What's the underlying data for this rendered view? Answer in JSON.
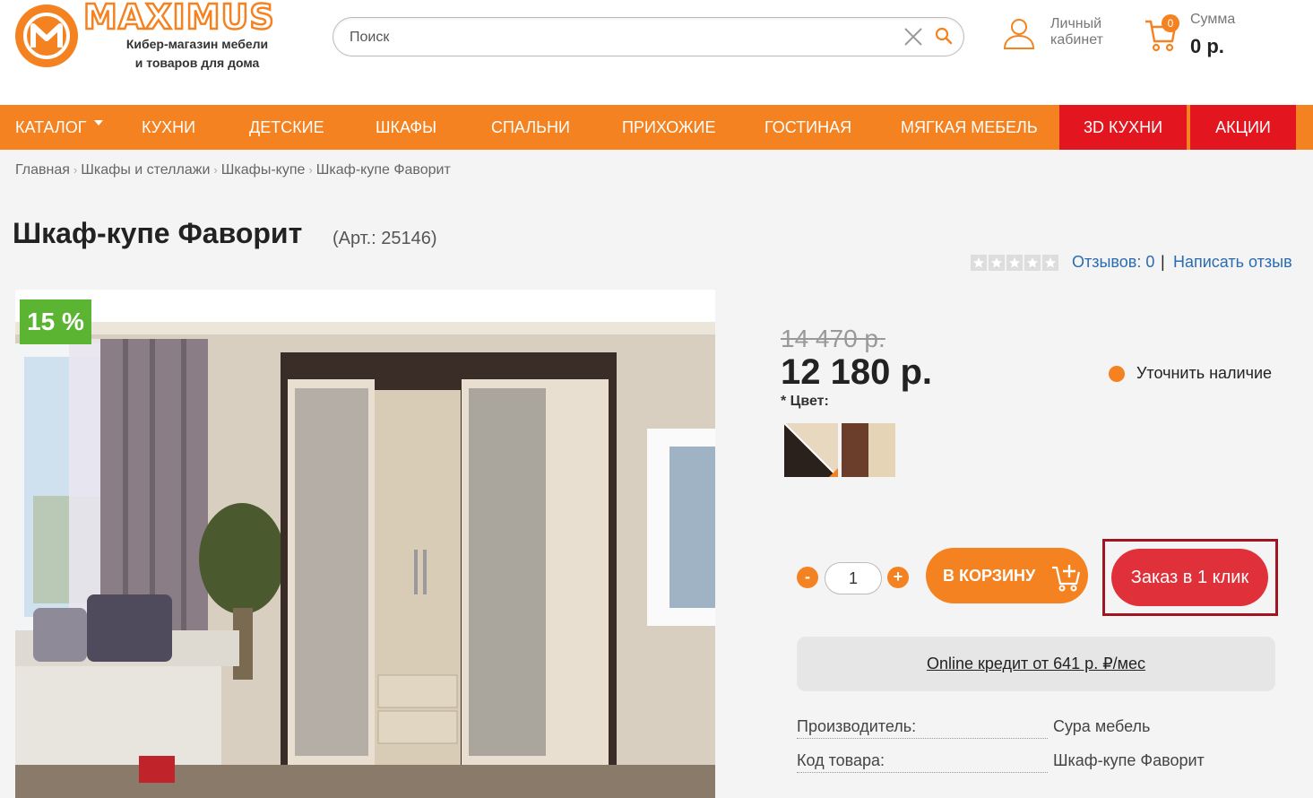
{
  "brand": {
    "name": "MAXIMUS",
    "tagline_line1": "Кибер-магазин мебели",
    "tagline_line2": "и товаров для дома"
  },
  "search": {
    "placeholder": "Поиск"
  },
  "account": {
    "line1": "Личный",
    "line2": "кабинет"
  },
  "cart": {
    "count": "0",
    "sum_label": "Сумма",
    "sum_value": "0 р."
  },
  "nav": {
    "items": [
      {
        "label": "КАТАЛОГ"
      },
      {
        "label": "КУХНИ"
      },
      {
        "label": "ДЕТСКИЕ"
      },
      {
        "label": "ШКАФЫ"
      },
      {
        "label": "СПАЛЬНИ"
      },
      {
        "label": "ПРИХОЖИЕ"
      },
      {
        "label": "ГОСТИНАЯ"
      },
      {
        "label": "МЯГКАЯ МЕБЕЛЬ"
      },
      {
        "label": "3D КУХНИ"
      },
      {
        "label": "АКЦИИ"
      }
    ]
  },
  "breadcrumb": [
    "Главная",
    "Шкафы и стеллажи",
    "Шкафы-купе",
    "Шкаф-купе Фаворит"
  ],
  "breadcrumb_sep": "›",
  "product": {
    "title": "Шкаф-купе Фаворит",
    "sku": "(Арт.: 25146)",
    "rating": 0,
    "reviews": "Отзывов: 0",
    "review_sep": "|",
    "write_review": "Написать отзыв",
    "discount": "15 %",
    "old_price": "14 470 р.",
    "price": "12 180 р.",
    "availability": "Уточнить наличие",
    "color_label": "* Цвет:",
    "colors": [
      "венге / беленый дуб",
      "орех / дуб молочный"
    ],
    "quantity": "1",
    "qty_minus": "-",
    "qty_plus": "+",
    "add_to_cart": "В КОРЗИНУ",
    "one_click": "Заказ в 1 клик",
    "credit": "Online кредит от 641 р. ₽/мес",
    "specs": [
      {
        "key": "Производитель:",
        "value": "Сура мебель"
      },
      {
        "key": "Код товара:",
        "value": "Шкаф-купе Фаворит"
      }
    ]
  },
  "colors": {
    "orange": "#f58220",
    "red": "#e3151e",
    "green": "#5cb532",
    "link": "#2b6cb0"
  }
}
